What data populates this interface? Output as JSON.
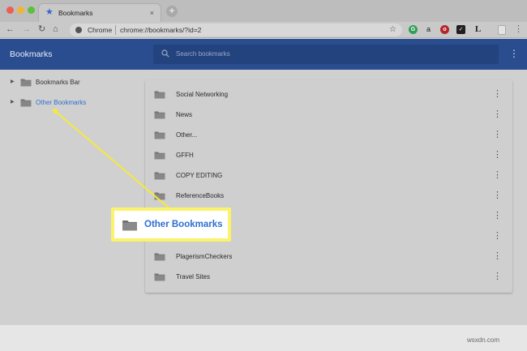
{
  "tab": {
    "title": "Bookmarks",
    "close": "×",
    "new_tab": "+"
  },
  "toolbar": {
    "back": "←",
    "forward": "→",
    "reload": "↻",
    "home": "⌂",
    "chrome_label": "Chrome",
    "url": "chrome://bookmarks/?id=2",
    "extensions": {
      "g": "G",
      "a": "a",
      "r": "o",
      "k": "✓",
      "l": "L"
    },
    "menu": "⋮"
  },
  "header": {
    "title": "Bookmarks",
    "search_placeholder": "Search bookmarks",
    "menu": "⋮"
  },
  "sidebar": {
    "items": [
      {
        "label": "Bookmarks Bar",
        "arrow": "▶",
        "active": false
      },
      {
        "label": "Other Bookmarks",
        "arrow": "▶",
        "active": true
      }
    ]
  },
  "list": {
    "menu_glyph": "⋮",
    "items": [
      {
        "label": "Social Networking"
      },
      {
        "label": "News"
      },
      {
        "label": "Other..."
      },
      {
        "label": "GFFH"
      },
      {
        "label": "COPY EDITING"
      },
      {
        "label": "ReferenceBooks"
      },
      {
        "label": ""
      },
      {
        "label": ""
      },
      {
        "label": "PlagerismCheckers"
      },
      {
        "label": "Travel Sites"
      }
    ]
  },
  "callout": {
    "label": "Other Bookmarks"
  },
  "watermark": "wsxdn.com",
  "colors": {
    "header_blue": "#2a4d8f",
    "link_blue": "#2e6fcf",
    "callout_yellow": "#fbf36a"
  }
}
